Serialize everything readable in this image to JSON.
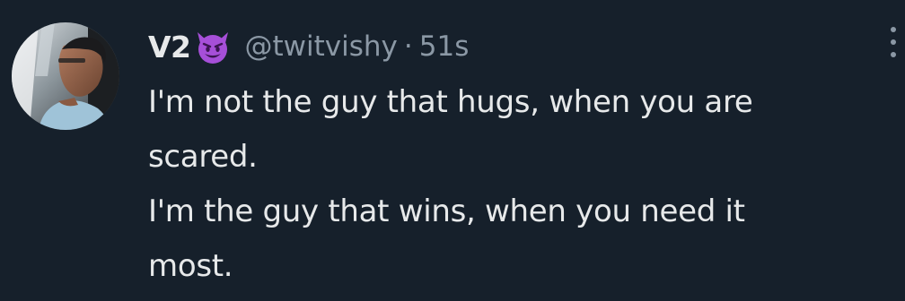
{
  "tweet": {
    "display_name": "V2",
    "name_emoji": "smiling-imp-emoji",
    "handle": "@twitvishy",
    "separator": "·",
    "time": "51s",
    "text_lines": [
      "I'm not the guy that hugs, when you are",
      "scared.",
      "I'm the guy that wins, when you need it",
      "most."
    ]
  },
  "colors": {
    "background": "#16202b",
    "text_primary": "#e7e9ea",
    "text_secondary": "#8b98a5",
    "emoji_purple": "#a64fd8"
  },
  "icons": {
    "more": "more-vertical-icon",
    "avatar": "profile-photo"
  }
}
